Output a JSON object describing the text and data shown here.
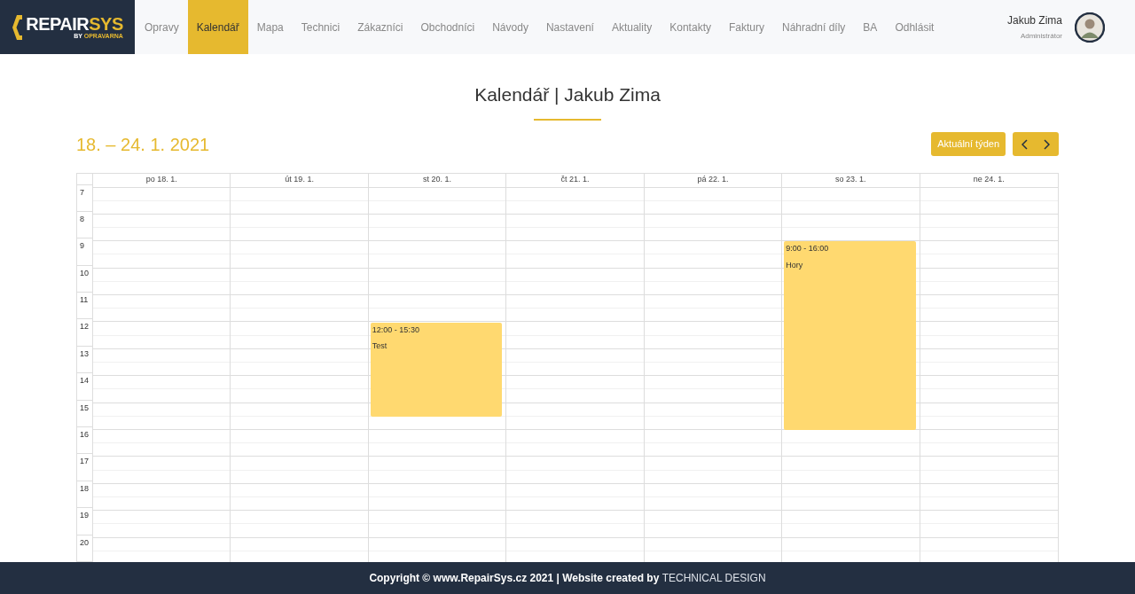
{
  "logo": {
    "word_1": "REPAIR",
    "word_2": "SYS",
    "tagline_1": "BY",
    "tagline_2": "OPRAVARNA"
  },
  "nav": [
    {
      "label": "Opravy",
      "selected": false
    },
    {
      "label": "Kalendář",
      "selected": true
    },
    {
      "label": "Mapa",
      "selected": false
    },
    {
      "label": "Technici",
      "selected": false
    },
    {
      "label": "Zákazníci",
      "selected": false
    },
    {
      "label": "Obchodníci",
      "selected": false
    },
    {
      "label": "Návody",
      "selected": false
    },
    {
      "label": "Nastavení",
      "selected": false
    },
    {
      "label": "Aktuality",
      "selected": false
    },
    {
      "label": "Kontakty",
      "selected": false
    },
    {
      "label": "Faktury",
      "selected": false
    },
    {
      "label": "Náhradní díly",
      "selected": false
    },
    {
      "label": "BA",
      "selected": false
    },
    {
      "label": "Odhlásit",
      "selected": false
    }
  ],
  "user": {
    "name": "Jakub Zima",
    "role": "Administrátor"
  },
  "page_title": "Kalendář | Jakub Zima",
  "week_range": "18. – 24. 1. 2021",
  "buttons": {
    "current_week": "Aktuální týden"
  },
  "hours": [
    "7",
    "8",
    "9",
    "10",
    "11",
    "12",
    "13",
    "14",
    "15",
    "16",
    "17",
    "18",
    "19",
    "20"
  ],
  "days": [
    {
      "label": "po 18. 1."
    },
    {
      "label": "út 19. 1."
    },
    {
      "label": "st 20. 1.",
      "events": [
        {
          "time": "12:00 - 15:30",
          "title": "Test"
        }
      ]
    },
    {
      "label": "čt 21. 1."
    },
    {
      "label": "pá 22. 1."
    },
    {
      "label": "so 23. 1.",
      "events": [
        {
          "time": "9:00 - 16:00",
          "title": "Hory"
        }
      ]
    },
    {
      "label": "ne 24. 1."
    }
  ],
  "footer": {
    "text": "Copyright © www.RepairSys.cz 2021 | Website created by",
    "link": "TECHNICAL DESIGN"
  }
}
